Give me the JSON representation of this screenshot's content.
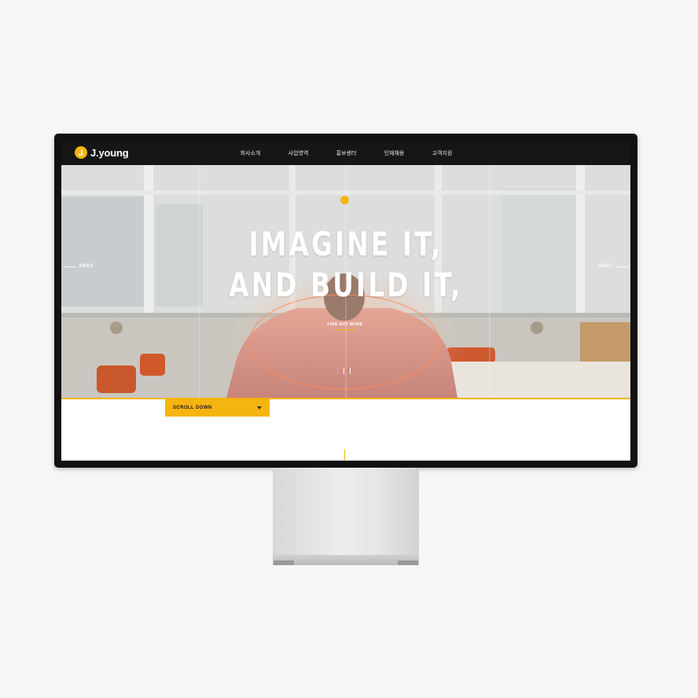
{
  "logo": {
    "text": "J.young"
  },
  "nav": {
    "items": [
      {
        "label": "회사소개"
      },
      {
        "label": "사업영역"
      },
      {
        "label": "홍보센터"
      },
      {
        "label": "인재채용"
      },
      {
        "label": "고객지원"
      }
    ]
  },
  "hero": {
    "headline_line1": "IMAGINE IT,",
    "headline_line2": "AND BUILD IT,",
    "prev_label": "PREV",
    "next_label": "NEXT",
    "cta_label": "FIND OUT MORE",
    "slide_count": 3,
    "active_slide": 1
  },
  "scroll": {
    "label": "SCROLL DOWN"
  },
  "colors": {
    "accent": "#f5b40f",
    "navbar": "#161616",
    "bezel": "#111111"
  },
  "icons": {
    "logo": "j-circle-icon",
    "scroll": "triangle-down-icon"
  }
}
